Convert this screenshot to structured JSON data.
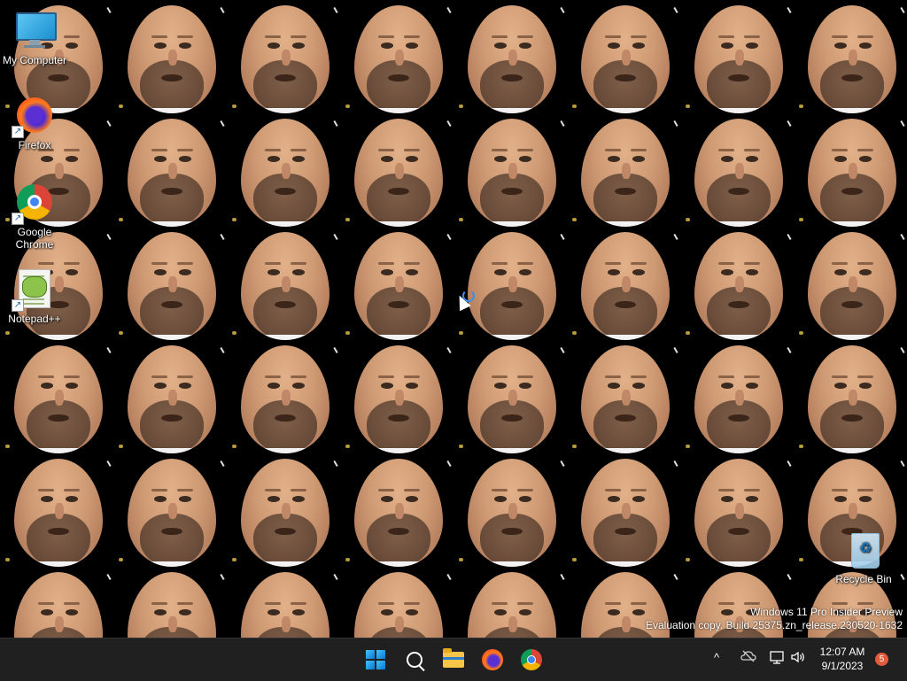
{
  "desktop": {
    "icons": [
      {
        "label": "My Computer",
        "icon": "computer-icon"
      },
      {
        "label": "Firefox",
        "icon": "firefox-icon"
      },
      {
        "label": "Google Chrome",
        "icon": "chrome-icon"
      },
      {
        "label": "Notepad++",
        "icon": "notepad-plus-plus-icon"
      },
      {
        "label": "Recycle Bin",
        "icon": "recycle-bin-icon"
      }
    ],
    "wallpaper": "tiled-face-photo",
    "watermark": {
      "line1": "Windows 11 Pro Insider Preview",
      "line2": "Evaluation copy. Build 25375.zn_release.230520-1632"
    }
  },
  "taskbar": {
    "pinned": [
      {
        "name": "start",
        "icon": "windows-start-icon"
      },
      {
        "name": "search",
        "icon": "search-icon"
      },
      {
        "name": "file-explorer",
        "icon": "folder-icon"
      },
      {
        "name": "firefox",
        "icon": "firefox-icon"
      },
      {
        "name": "chrome",
        "icon": "chrome-icon"
      }
    ],
    "tray": {
      "overflow_glyph": "^",
      "clock_time": "12:07 AM",
      "clock_date": "9/1/2023",
      "notification_count": "5"
    }
  },
  "colors": {
    "taskbar_bg": "#202020",
    "desktop_bg": "#000000",
    "accent": "#0a78d4"
  }
}
